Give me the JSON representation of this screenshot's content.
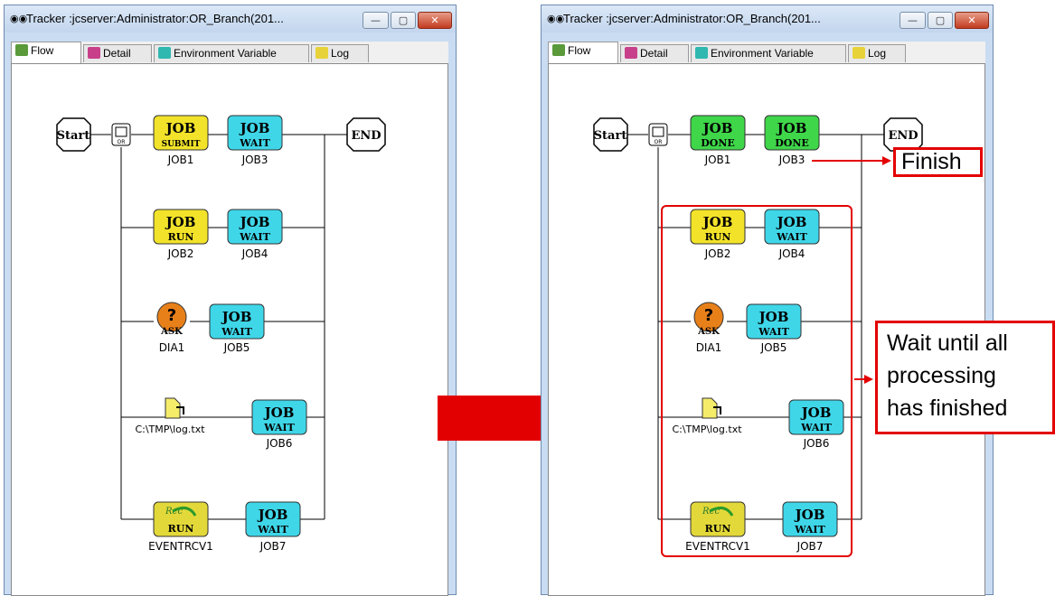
{
  "left_window": {
    "title": "Tracker :jcserver:Administrator:OR_Branch(201...",
    "tabs": [
      "Flow",
      "Detail",
      "Environment Variable",
      "Log"
    ],
    "start_label": "Start",
    "end_label": "END",
    "jobs": {
      "job1": {
        "top": "JOB",
        "status": "SUBMIT",
        "name": "JOB1"
      },
      "job3": {
        "top": "JOB",
        "status": "WAIT",
        "name": "JOB3"
      },
      "job2": {
        "top": "JOB",
        "status": "RUN",
        "name": "JOB2"
      },
      "job4": {
        "top": "JOB",
        "status": "WAIT",
        "name": "JOB4"
      },
      "dia1": {
        "status": "ASK",
        "name": "DIA1"
      },
      "job5": {
        "top": "JOB",
        "status": "WAIT",
        "name": "JOB5"
      },
      "file": {
        "name": "C:\\TMP\\log.txt"
      },
      "job6": {
        "top": "JOB",
        "status": "WAIT",
        "name": "JOB6"
      },
      "evt": {
        "top": "Rec",
        "status": "RUN",
        "name": "EVENTRCV1"
      },
      "job7": {
        "top": "JOB",
        "status": "WAIT",
        "name": "JOB7"
      }
    }
  },
  "right_window": {
    "title": "Tracker :jcserver:Administrator:OR_Branch(201...",
    "tabs": [
      "Flow",
      "Detail",
      "Environment Variable",
      "Log"
    ],
    "start_label": "Start",
    "end_label": "END",
    "jobs": {
      "job1": {
        "top": "JOB",
        "status": "DONE",
        "name": "JOB1"
      },
      "job3": {
        "top": "JOB",
        "status": "DONE",
        "name": "JOB3"
      },
      "job2": {
        "top": "JOB",
        "status": "RUN",
        "name": "JOB2"
      },
      "job4": {
        "top": "JOB",
        "status": "WAIT",
        "name": "JOB4"
      },
      "dia1": {
        "status": "ASK",
        "name": "DIA1"
      },
      "job5": {
        "top": "JOB",
        "status": "WAIT",
        "name": "JOB5"
      },
      "file": {
        "name": "C:\\TMP\\log.txt"
      },
      "job6": {
        "top": "JOB",
        "status": "WAIT",
        "name": "JOB6"
      },
      "evt": {
        "top": "Rec",
        "status": "RUN",
        "name": "EVENTRCV1"
      },
      "job7": {
        "top": "JOB",
        "status": "WAIT",
        "name": "JOB7"
      }
    }
  },
  "callouts": {
    "finish": "Finish",
    "wait_lines": [
      "Wait until all",
      "processing",
      "has finished"
    ]
  },
  "colors": {
    "submit": "#f2e32a",
    "run": "#f2e32a",
    "wait": "#3fd6e8",
    "done": "#3fd64a",
    "ask": "#e8801a",
    "accent_red": "#e30000"
  }
}
